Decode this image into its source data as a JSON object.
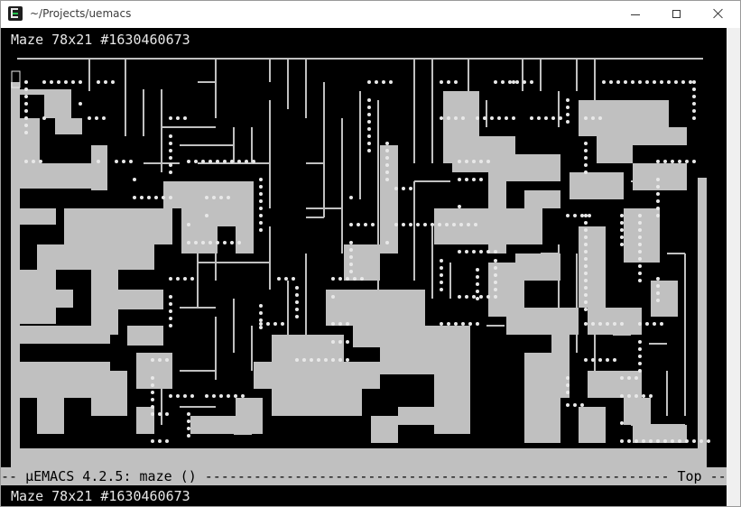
{
  "window": {
    "title": "~/Projects/uemacs",
    "minimize_label": "",
    "maximize_label": "",
    "close_label": ""
  },
  "buffer": {
    "header": "Maze 78x21 #1630460673"
  },
  "modeline": {
    "left": "-- µEMACS 4.2.5: maze () ",
    "right": " Top --"
  },
  "minibuffer": {
    "text": "Maze 78x21 #1630460673"
  },
  "colors": {
    "terminal_bg": "#000000",
    "maze_fill": "#c0c0c0",
    "wall_line": "#c0c0c0",
    "dot": "#e8e8e8",
    "modeline_bg": "#c0c0c0"
  }
}
